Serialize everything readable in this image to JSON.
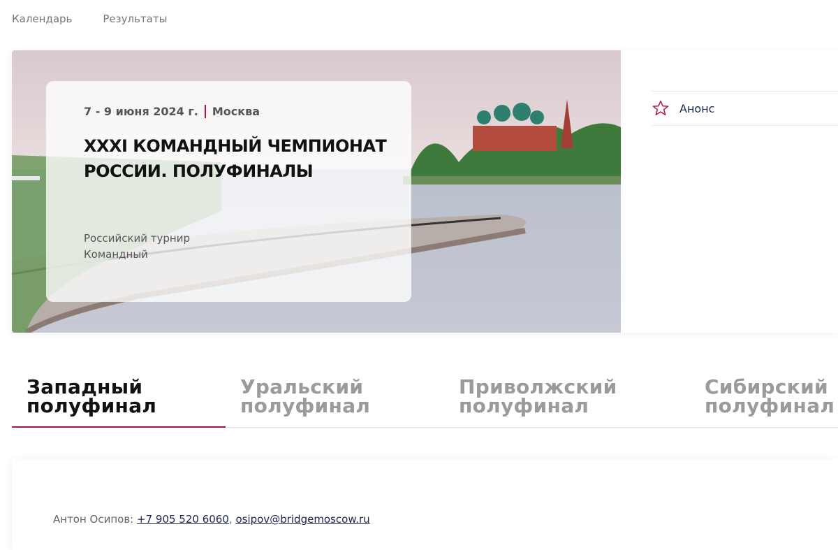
{
  "nav": {
    "items": [
      "Календарь",
      "Результаты"
    ]
  },
  "event": {
    "dates": "7 - 9 июня 2024 г.",
    "city": "Москва",
    "title": "XXXI КОМАНДНЫЙ ЧЕМПИОНАТ РОССИИ. ПОЛУФИНАЛЫ",
    "tag_type": "Российский турнир",
    "tag_format": "Командный"
  },
  "status": {
    "icon": "star-outline-icon",
    "label": "Анонс",
    "accent": "#b0163e"
  },
  "tabs": [
    {
      "line1": "Западный",
      "line2": "полуфинал",
      "active": true
    },
    {
      "line1": "Уральский",
      "line2": "полуфинал",
      "active": false
    },
    {
      "line1": "Приволжский",
      "line2": "полуфинал",
      "active": false
    },
    {
      "line1": "Сибирский",
      "line2": "полуфинал",
      "active": false
    }
  ],
  "contact": {
    "name": "Антон Осипов:",
    "phone": "+7 905 520 6060",
    "separator": ",",
    "email": "osipov@bridgemoscow.ru"
  },
  "colors": {
    "accent": "#a0173f",
    "link": "#1c2453"
  }
}
